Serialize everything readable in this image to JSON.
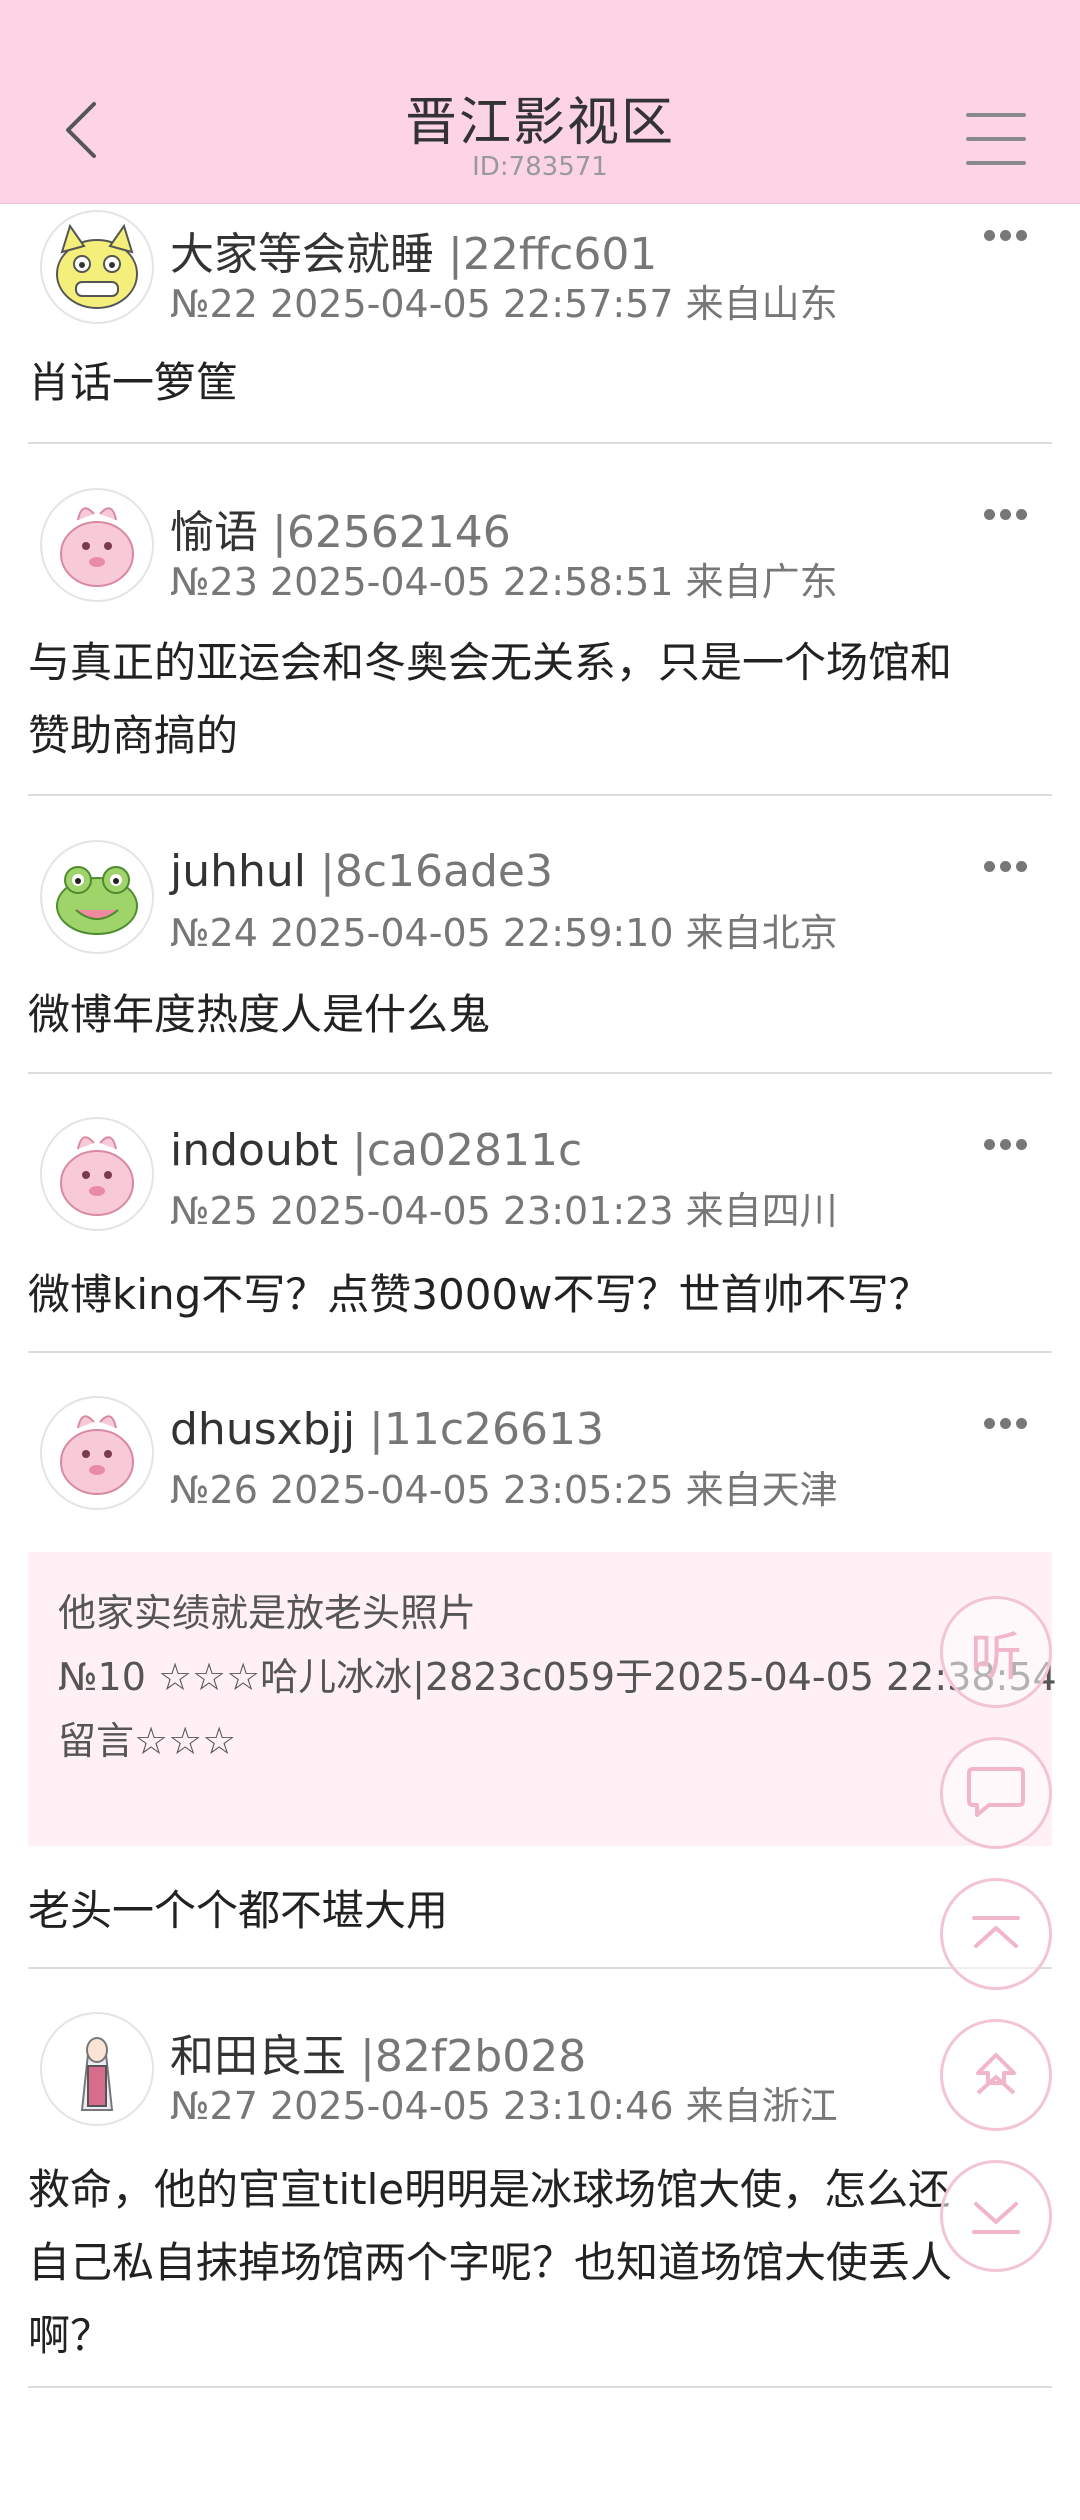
{
  "header": {
    "title": "晋江影视区",
    "subtitle": "ID:783571"
  },
  "posts": [
    {
      "username": "大家等会就睡",
      "uid": "|22ffc601",
      "meta": "№22 2025-04-05 22:57:57 来自山东",
      "content": "肖话一箩筐",
      "avatar": "yellow-cat-avatar"
    },
    {
      "username": "愉语",
      "uid": "|62562146",
      "meta": "№23 2025-04-05 22:58:51 来自广东",
      "content_lines": [
        "与真正的亚运会和冬奥会无关系，只是一个场馆和",
        "赞助商搞的"
      ],
      "avatar": "pink-creature-avatar"
    },
    {
      "username": "juhhul",
      "uid": "|8c16ade3",
      "meta": "№24 2025-04-05 22:59:10 来自北京",
      "content": "微博年度热度人是什么鬼",
      "avatar": "frog-avatar"
    },
    {
      "username": "indoubt",
      "uid": "|ca02811c",
      "meta": "№25 2025-04-05 23:01:23 来自四川",
      "content": "微博king不写？点赞3000w不写？世首帅不写？",
      "avatar": "pink-creature-avatar"
    },
    {
      "username": "dhusxbjj",
      "uid": "|11c26613",
      "meta": "№26 2025-04-05 23:05:25 来自天津",
      "quote": {
        "line1": "他家实绩就是放老头照片",
        "line2": "№10 ☆☆☆哈儿冰冰|2823c059于2025-04-05 22:38:54",
        "line3": "留言☆☆☆"
      },
      "content": "老头一个个都不堪大用",
      "avatar": "pink-creature-avatar"
    },
    {
      "username": "和田良玉",
      "uid": "|82f2b028",
      "meta": "№27 2025-04-05 23:10:46 来自浙江",
      "content_lines": [
        "救命，他的官宣title明明是冰球场馆大使，怎么还",
        "自己私自抹掉场馆两个字呢？也知道场馆大使丢人",
        "啊？"
      ],
      "avatar": "anime-girl-avatar"
    }
  ],
  "floating_buttons": {
    "listen_label": "听"
  },
  "colors": {
    "header_bg": "#fcd4e6",
    "quote_bg": "#fff0f6",
    "float_accent": "#f3c4d6"
  }
}
